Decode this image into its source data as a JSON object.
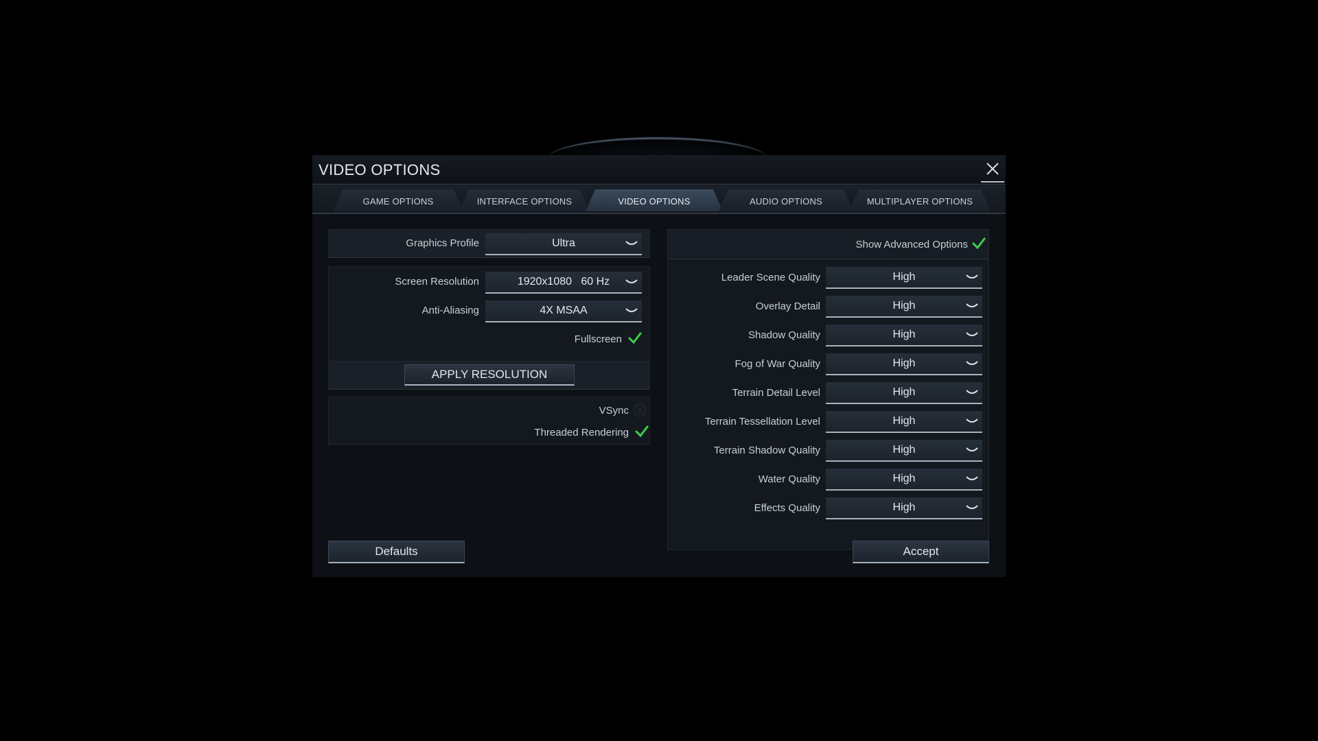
{
  "dialog": {
    "title": "VIDEO OPTIONS"
  },
  "tabs": [
    {
      "label": "GAME OPTIONS",
      "active": false
    },
    {
      "label": "INTERFACE OPTIONS",
      "active": false
    },
    {
      "label": "VIDEO OPTIONS",
      "active": true
    },
    {
      "label": "AUDIO OPTIONS",
      "active": false
    },
    {
      "label": "MULTIPLAYER OPTIONS",
      "active": false
    }
  ],
  "left": {
    "graphics_profile": {
      "label": "Graphics Profile",
      "value": "Ultra"
    },
    "screen_resolution": {
      "label": "Screen Resolution",
      "value": "1920x1080   60 Hz"
    },
    "anti_aliasing": {
      "label": "Anti-Aliasing",
      "value": "4X MSAA"
    },
    "fullscreen": {
      "label": "Fullscreen",
      "checked": true
    },
    "apply_label": "APPLY RESOLUTION",
    "vsync": {
      "label": "VSync",
      "checked": false
    },
    "threaded_rendering": {
      "label": "Threaded Rendering",
      "checked": true
    }
  },
  "right": {
    "show_advanced": {
      "label": "Show Advanced Options",
      "checked": true
    },
    "settings": [
      {
        "label": "Leader Scene Quality",
        "value": "High"
      },
      {
        "label": "Overlay Detail",
        "value": "High"
      },
      {
        "label": "Shadow Quality",
        "value": "High"
      },
      {
        "label": "Fog of War Quality",
        "value": "High"
      },
      {
        "label": "Terrain Detail Level",
        "value": "High"
      },
      {
        "label": "Terrain Tessellation Level",
        "value": "High"
      },
      {
        "label": "Terrain Shadow Quality",
        "value": "High"
      },
      {
        "label": "Water Quality",
        "value": "High"
      },
      {
        "label": "Effects Quality",
        "value": "High"
      }
    ]
  },
  "footer": {
    "defaults_label": "Defaults",
    "accept_label": "Accept"
  },
  "colors": {
    "accent_check": "#3ecf4a",
    "background": "#000000",
    "panel": "#14191f"
  },
  "icons": {
    "close": "close-x-icon",
    "dropdown": "chevron-down-icon",
    "check": "checkmark-icon"
  }
}
